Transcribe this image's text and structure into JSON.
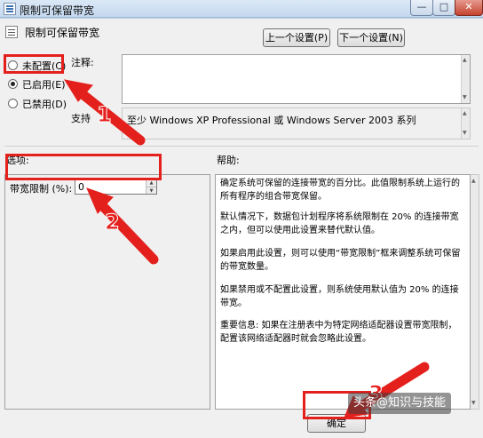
{
  "window": {
    "title": "限制可保留带宽",
    "min_glyph": "—",
    "max_glyph": "□",
    "close_glyph": "✕"
  },
  "policy": {
    "name": "限制可保留带宽",
    "prev_button": "上一个设置(P)",
    "next_button": "下一个设置(N)"
  },
  "state_options": [
    {
      "label": "未配置(C)",
      "checked": false
    },
    {
      "label": "已启用(E)",
      "checked": true
    },
    {
      "label": "已禁用(D)",
      "checked": false
    }
  ],
  "comment": {
    "label": "注释:",
    "value": ""
  },
  "supported_on": {
    "label": "支持",
    "text": "至少 Windows XP Professional 或 Windows Server 2003 系列"
  },
  "options": {
    "section_label": "选项:",
    "bandwidth_label": "带宽限制 (%):",
    "bandwidth_value": "0"
  },
  "help": {
    "section_label": "帮助:",
    "paragraphs": [
      "确定系统可保留的连接带宽的百分比。此值限制系统上运行的所有程序的组合带宽保留。",
      "默认情况下，数据包计划程序将系统限制在 20% 的连接带宽之内，但可以使用此设置来替代默认值。",
      "如果启用此设置，则可以使用“带宽限制”框来调整系统可保留的带宽数量。",
      "如果禁用或不配置此设置，则系统使用默认值为 20% 的连接带宽。",
      "重要信息: 如果在注册表中为特定网络适配器设置带宽限制，配置该网络适配器时就会忽略此设置。"
    ]
  },
  "buttons": {
    "ok": "确定"
  },
  "annotations": {
    "steps": [
      "1",
      "2",
      "3"
    ],
    "color": "#e4201d"
  },
  "watermark": "头条@知识与技能"
}
